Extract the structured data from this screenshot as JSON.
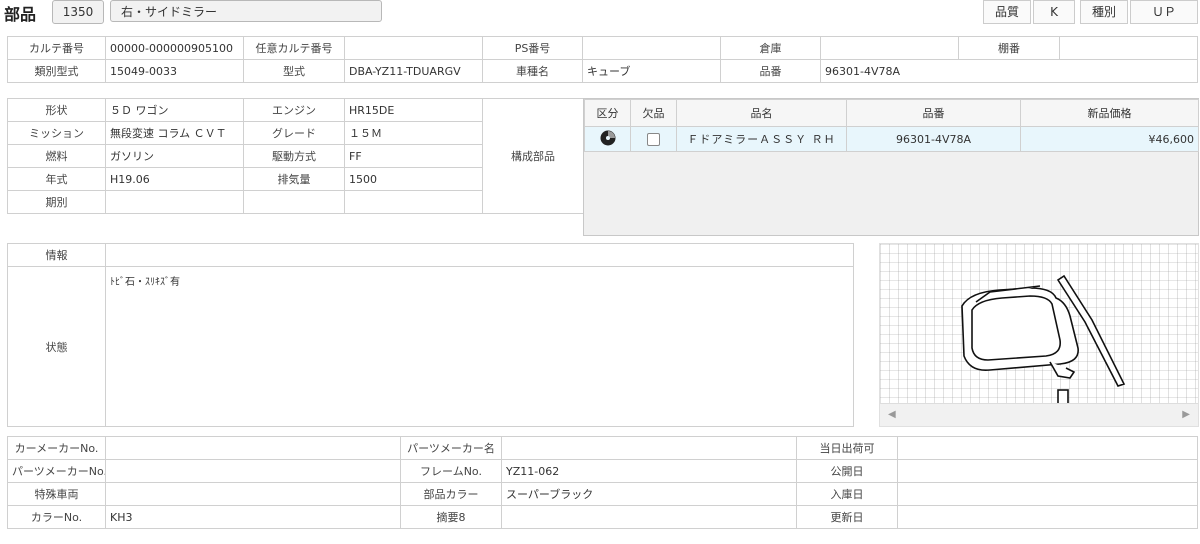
{
  "header": {
    "title": "部品",
    "code": "1350",
    "part_name": "右・サイドミラー",
    "quality_label": "品質",
    "quality_value": "K",
    "type_label": "種別",
    "type_value": "ＵＰ"
  },
  "record": {
    "karte_no_label": "カルテ番号",
    "karte_no": "00000-000000905100",
    "free_karte_label": "任意カルテ番号",
    "free_karte": "",
    "ps_no_label": "PS番号",
    "ps_no": "",
    "warehouse_label": "倉庫",
    "warehouse": "",
    "shelf_label": "棚番",
    "shelf": "",
    "category_type_label": "類別型式",
    "category_type": "15049-0033",
    "model_label": "型式",
    "model": "DBA-YZ11-TDUARGV",
    "car_name_label": "車種名",
    "car_name": "キューブ",
    "part_no_label": "品番",
    "part_no": "96301-4V78A"
  },
  "spec": {
    "shape_label": "形状",
    "shape": "５Ｄ ワゴン",
    "engine_label": "エンジン",
    "engine": "HR15DE",
    "mission_label": "ミッション",
    "mission": "無段変速 コラム ＣＶＴ",
    "grade_label": "グレード",
    "grade": "１５Ｍ",
    "fuel_label": "燃料",
    "fuel": "ガソリン",
    "drive_label": "駆動方式",
    "drive": "FF",
    "year_label": "年式",
    "year": "H19.06",
    "displacement_label": "排気量",
    "displacement": "1500",
    "period_label": "期別",
    "period": "",
    "components_label": "構成部品"
  },
  "parts_table": {
    "headers": [
      "区分",
      "欠品",
      "品名",
      "品番",
      "新品価格"
    ],
    "rows": [
      {
        "name": "ＦドアミラーＡＳＳＹ ＲＨ",
        "part_no": "96301-4V78A",
        "price": "¥46,600"
      }
    ]
  },
  "info": {
    "info_label": "情報",
    "info": "",
    "status_label": "状態",
    "status": "ﾄﾋﾞ石・ｽﾘｷｽﾞ有"
  },
  "bottom": {
    "car_maker_no_label": "カーメーカーNo.",
    "car_maker_no": "",
    "parts_maker_name_label": "パーツメーカー名",
    "parts_maker_name": "",
    "same_day_label": "当日出荷可",
    "same_day": "",
    "parts_maker_no_label": "パーツメーカーNo.",
    "parts_maker_no": "",
    "frame_no_label": "フレームNo.",
    "frame_no": "YZ11-062",
    "publish_date_label": "公開日",
    "publish_date": "",
    "special_vehicle_label": "特殊車両",
    "special_vehicle": "",
    "part_color_label": "部品カラー",
    "part_color": "スーパーブラック",
    "stock_date_label": "入庫日",
    "stock_date": "",
    "color_no_label": "カラーNo.",
    "color_no": "KH3",
    "summary_label": "摘要8",
    "summary": "",
    "update_date_label": "更新日",
    "update_date": ""
  }
}
